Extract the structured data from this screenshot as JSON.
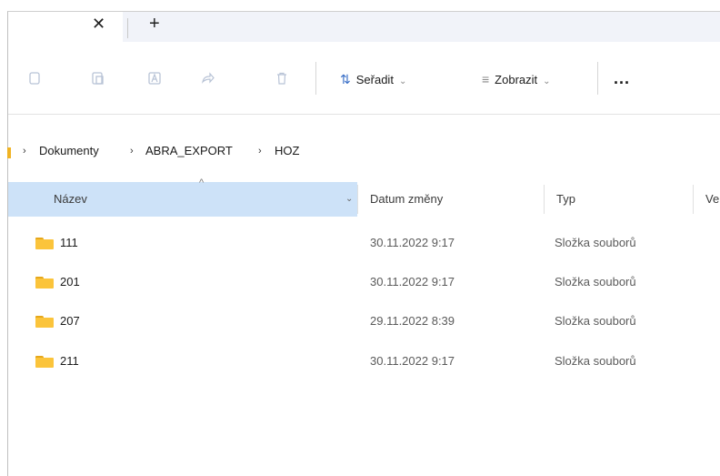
{
  "tabs": {
    "close_glyph": "✕",
    "new_glyph": "+"
  },
  "toolbar": {
    "sort_label": "Seřadit",
    "view_label": "Zobrazit",
    "more_label": "..."
  },
  "breadcrumb": {
    "items": [
      "Dokumenty",
      "ABRA_EXPORT",
      "HOZ"
    ],
    "separator": "›"
  },
  "columns": {
    "name": "Název",
    "date": "Datum změny",
    "type": "Typ",
    "size_partial": "Ve"
  },
  "files": [
    {
      "name": "111",
      "date": "30.11.2022 9:17",
      "type": "Složka souborů"
    },
    {
      "name": "201",
      "date": "30.11.2022 9:17",
      "type": "Složka souborů"
    },
    {
      "name": "207",
      "date": "29.11.2022 8:39",
      "type": "Složka souborů"
    },
    {
      "name": "211",
      "date": "30.11.2022 9:17",
      "type": "Složka souborů"
    }
  ],
  "colors": {
    "header_selected": "#cde2f8",
    "folder": "#fbc43b",
    "accent": "#3a6fc7"
  }
}
